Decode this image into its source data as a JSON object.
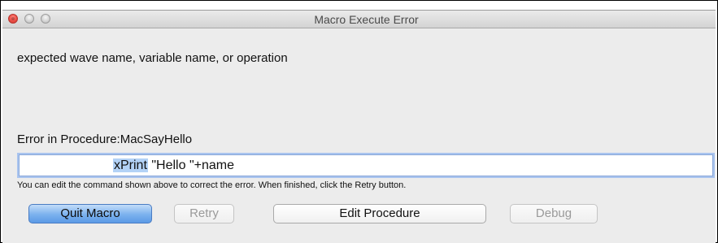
{
  "window": {
    "title": "Macro Execute Error"
  },
  "message": "expected wave name, variable name, or operation",
  "error_location": "Error in Procedure:MacSayHello",
  "command": {
    "highlighted": "xPrint",
    "rest": " \"Hello \"+name"
  },
  "hint": "You can edit the command shown above to correct the error. When finished, click the Retry button.",
  "buttons": {
    "quit_label": "Quit Macro",
    "retry_label": "Retry",
    "edit_label": "Edit Procedure",
    "debug_label": "Debug"
  },
  "colors": {
    "close_button": "#ec4d45",
    "default_button": "#5b9ae6",
    "selection_highlight": "#b3d2f6",
    "focus_ring": "#a9c4ef"
  },
  "icons": {
    "close": "close-icon",
    "minimize": "minimize-icon",
    "zoom": "zoom-icon"
  }
}
